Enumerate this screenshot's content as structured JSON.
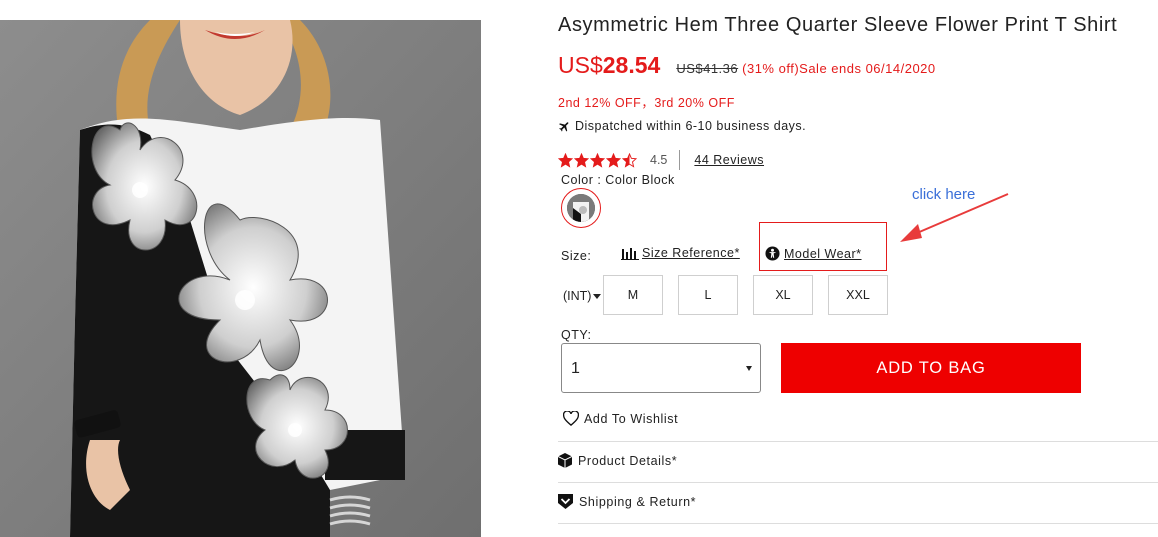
{
  "product": {
    "title": "Asymmetric Hem Three Quarter Sleeve Flower Print T Shirt",
    "image_alt": "Model wearing black and white flower print shirt"
  },
  "price": {
    "currency": "US$",
    "current": "28.54",
    "original": "US$41.36",
    "discount_note": "(31% off)Sale ends 06/14/2020"
  },
  "promo": "2nd 12% OFF，3rd 20% OFF",
  "dispatch": {
    "icon": "plane-icon",
    "text": "Dispatched within 6-10 business days."
  },
  "rating": {
    "stars": 4.5,
    "value": "4.5",
    "reviews_link": "44 Reviews"
  },
  "color": {
    "label": "Color : Color Block",
    "selected_swatch": "Color Block"
  },
  "annotation": {
    "text": "click here",
    "color": "#3a6fd8"
  },
  "size": {
    "label": "Size:",
    "reference_link": "Size Reference*",
    "model_wear_link": "Model Wear*",
    "system": "(INT)",
    "options": [
      "M",
      "L",
      "XL",
      "XXL"
    ]
  },
  "qty": {
    "label": "QTY:",
    "value": "1"
  },
  "actions": {
    "add_to_bag": "ADD TO BAG",
    "wishlist": "Add To Wishlist"
  },
  "sections": {
    "product_details": "Product Details*",
    "shipping_return": "Shipping & Return*"
  },
  "colors": {
    "accent_red": "#e41b1b",
    "button_red": "#ee0000",
    "annotation_blue": "#3a6fd8"
  }
}
